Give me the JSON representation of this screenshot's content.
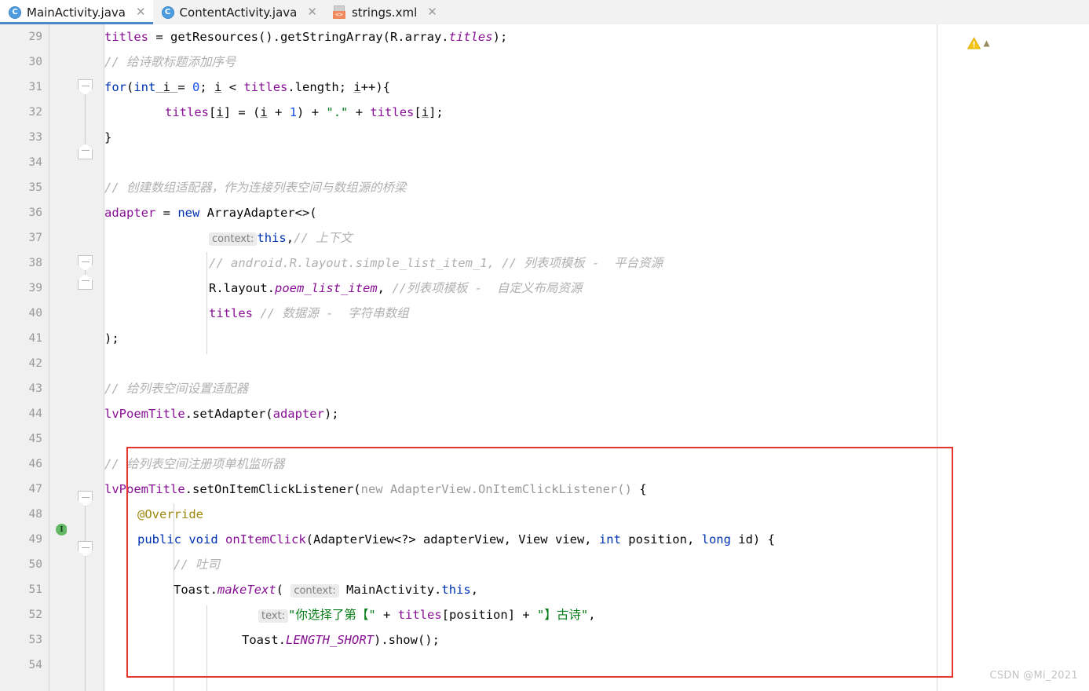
{
  "window": {
    "watermark": "CSDN @Mi_2021"
  },
  "tabs": [
    {
      "label": "MainActivity.java",
      "icon": "java-class-icon",
      "active": true,
      "close": "✕"
    },
    {
      "label": "ContentActivity.java",
      "icon": "java-class-icon",
      "active": false,
      "close": "✕"
    },
    {
      "label": "strings.xml",
      "icon": "xml-resource-icon",
      "active": false,
      "close": "✕"
    }
  ],
  "editor": {
    "first_line": 29,
    "last_line": 54,
    "line_numbers": [
      29,
      30,
      31,
      32,
      33,
      34,
      35,
      36,
      37,
      38,
      39,
      40,
      41,
      42,
      43,
      44,
      45,
      46,
      47,
      48,
      49,
      50,
      51,
      52,
      53,
      54
    ],
    "gutter_markers": {
      "fold_lines": [
        31,
        33,
        37,
        38,
        47,
        49
      ],
      "implementation_marker_line": 49,
      "implementation_marker_glyph": "I"
    },
    "inlay_hints": {
      "context_1": "context:",
      "context_2": "context:",
      "text_1": "text:"
    },
    "lines": [
      {
        "n": 29,
        "text": "titles = getResources().getStringArray(R.array.titles);"
      },
      {
        "n": 30,
        "text": "// 给诗歌标题添加序号"
      },
      {
        "n": 31,
        "text": "for(int i = 0; i < titles.length; i++){"
      },
      {
        "n": 32,
        "text": "titles[i] = (i + 1) + \".\" + titles[i];"
      },
      {
        "n": 33,
        "text": "}"
      },
      {
        "n": 34,
        "text": ""
      },
      {
        "n": 35,
        "text": "// 创建数组适配器，作为连接列表空间与数组源的桥梁"
      },
      {
        "n": 36,
        "text": "adapter = new ArrayAdapter<>("
      },
      {
        "n": 37,
        "text": "context: this,// 上下文"
      },
      {
        "n": 38,
        "text": "// android.R.layout.simple_list_item_1, // 列表项模板 - 平台资源"
      },
      {
        "n": 39,
        "text": "R.layout.poem_list_item, //列表项模板 - 自定义布局资源"
      },
      {
        "n": 40,
        "text": "titles // 数据源 - 字符串数组"
      },
      {
        "n": 41,
        "text": ");"
      },
      {
        "n": 42,
        "text": ""
      },
      {
        "n": 43,
        "text": "// 给列表空间设置适配器"
      },
      {
        "n": 44,
        "text": "lvPoemTitle.setAdapter(adapter);"
      },
      {
        "n": 45,
        "text": ""
      },
      {
        "n": 46,
        "text": "// 给列表空间注册项单机监听器"
      },
      {
        "n": 47,
        "text": "lvPoemTitle.setOnItemClickListener(new AdapterView.OnItemClickListener() {"
      },
      {
        "n": 48,
        "text": "@Override"
      },
      {
        "n": 49,
        "text": "public void onItemClick(AdapterView<?> adapterView, View view, int position, long id) {"
      },
      {
        "n": 50,
        "text": "// 吐司"
      },
      {
        "n": 51,
        "text": "Toast.makeText( context: MainActivity.this,"
      },
      {
        "n": 52,
        "text": "text: \"你选择了第【\" + titles[position] + \"】古诗\","
      },
      {
        "n": 53,
        "text": "Toast.LENGTH_SHORT).show();"
      },
      {
        "n": 54,
        "text": ""
      }
    ],
    "tokens": {
      "l29": {
        "t1": "titles",
        "t2": " = getResources().getStringArray(R.array.",
        "t3": "titles",
        "t4": ");"
      },
      "l30": {
        "slashes": "// ",
        "comment": "给诗歌标题添加序号"
      },
      "l31": {
        "kw_for": "for",
        "p1": "(",
        "kw_int": "int",
        "v1": " i ",
        "p2": "= ",
        "zero": "0",
        "p3": "; ",
        "v2": "i",
        "p4": " < ",
        "f1": "titles",
        "p5": ".length; ",
        "v3": "i",
        "p6": "++){"
      },
      "l32": {
        "f1": "titles",
        "b1": "[",
        "v1": "i",
        "b2": "] = (",
        "v2": "i",
        "b3": " + ",
        "one": "1",
        "b4": ") + ",
        "dot": "\".\"",
        "b5": " + ",
        "f2": "titles",
        "b6": "[",
        "v3": "i",
        "b7": "];"
      },
      "l33": {
        "brace": "}"
      },
      "l35": {
        "slashes": "// ",
        "comment": "创建数组适配器，作为连接列表空间与数组源的桥梁"
      },
      "l36": {
        "f1": "adapter",
        "p1": " = ",
        "kw_new": "new",
        "p2": " ArrayAdapter<>("
      },
      "l37": {
        "hint": "context:",
        "kw_this": "this",
        "comma": ",",
        "slashes": "// ",
        "comment": "上下文"
      },
      "l38": {
        "comment": "// android.R.layout.simple_list_item_1, // 列表项模板 -  平台资源"
      },
      "l39": {
        "p1": "R.layout.",
        "sfld": "poem_list_item",
        "p2": ", ",
        "comment": "//列表项模板 -  自定义布局资源"
      },
      "l40": {
        "f1": "titles",
        "comment": " // 数据源 -  字符串数组"
      },
      "l41": {
        "p1": ");"
      },
      "l43": {
        "slashes": "// ",
        "comment": "给列表空间设置适配器"
      },
      "l44": {
        "f1": "lvPoemTitle",
        "p1": ".setAdapter(",
        "f2": "adapter",
        "p2": ");"
      },
      "l46": {
        "slashes": "// ",
        "comment": "给列表空间注册项单机监听器"
      },
      "l47": {
        "f1": "lvPoemTitle",
        "p1": ".setOnItemClickListener(",
        "kw_new": "new",
        "gray": " AdapterView.OnItemClickListener()",
        "p2": " {"
      },
      "l48": {
        "anno": "@Override"
      },
      "l49": {
        "kw1": "public",
        "sp1": " ",
        "kw2": "void",
        "sp2": " ",
        "m": "onItemClick",
        "p1": "(AdapterView<?> adapterView, View view, ",
        "kw3": "int",
        "p2": " position, ",
        "kw4": "long",
        "p3": " id) {"
      },
      "l50": {
        "slashes": "// ",
        "comment": "吐司"
      },
      "l51": {
        "p1": "Toast.",
        "m": "makeText",
        "p2": "( ",
        "hint": "context:",
        "p3": " MainActivity.",
        "kw_this": "this",
        "p4": ","
      },
      "l52": {
        "hint": "text:",
        "s1": "\"你选择了第【\"",
        "p1": " + ",
        "f1": "titles",
        "p2": "[position] + ",
        "s2": "\"】古诗\"",
        "p3": ","
      },
      "l53": {
        "p1": "Toast.",
        "sfld": "LENGTH_SHORT",
        "p2": ").show();"
      }
    }
  },
  "annotations": {
    "highlight_box_color": "#e8342a",
    "warning_icon": "warning-triangle-icon"
  },
  "colors": {
    "keyword": "#0033b3",
    "field": "#871094",
    "comment": "#b0b0b0",
    "string": "#067d17",
    "number": "#1750eb",
    "annotation": "#9e880d",
    "tab_active_underline": "#4a88c7",
    "gutter_bg": "#f0f0f0",
    "editor_bg": "#ffffff"
  }
}
